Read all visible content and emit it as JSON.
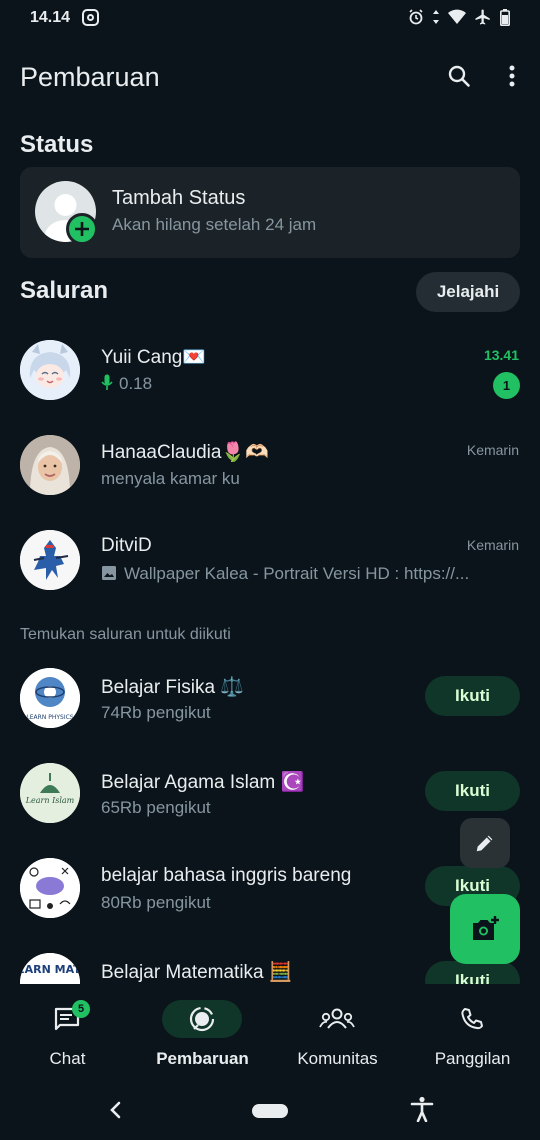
{
  "status_bar": {
    "time": "14.14"
  },
  "header": {
    "title": "Pembaruan"
  },
  "status_section": {
    "title": "Status",
    "card": {
      "name": "Tambah Status",
      "subtitle": "Akan hilang setelah 24 jam"
    }
  },
  "channels_section": {
    "title": "Saluran",
    "explore_label": "Jelajahi"
  },
  "channels": [
    {
      "name": "Yuii Cang",
      "emoji": "💌",
      "subtitle": "0.18",
      "time": "13.41",
      "unread": "1"
    },
    {
      "name": "HanaaClaudia",
      "emoji": "🌷🫶🏻",
      "subtitle": "menyala kamar ku",
      "time": "Kemarin"
    },
    {
      "name": "DitviD",
      "subtitle": "Wallpaper Kalea - Portrait Versi HD : https://...",
      "time": "Kemarin"
    }
  ],
  "discover": {
    "label": "Temukan saluran untuk diikuti",
    "follow_label": "Ikuti",
    "items": [
      {
        "name": "Belajar Fisika ⚖️",
        "followers": "74Rb pengikut"
      },
      {
        "name": "Belajar Agama Islam ☪️",
        "followers": "65Rb pengikut"
      },
      {
        "name": "belajar bahasa inggris bareng",
        "followers": "80Rb pengikut"
      },
      {
        "name": "Belajar Matematika 🧮",
        "followers": ""
      }
    ]
  },
  "avatar_texts": {
    "learn_math": "LEARN MATH",
    "learn_physics": "LEARN PHYSICS",
    "learn_islam": "Learn Islam"
  },
  "nav": {
    "items": [
      {
        "label": "Chat",
        "badge": "5"
      },
      {
        "label": "Pembaruan",
        "active": true
      },
      {
        "label": "Komunitas"
      },
      {
        "label": "Panggilan"
      }
    ]
  },
  "colors": {
    "accent": "#21c063",
    "background": "#0b141a",
    "card": "#1c2328",
    "follow_bg": "#103529"
  }
}
